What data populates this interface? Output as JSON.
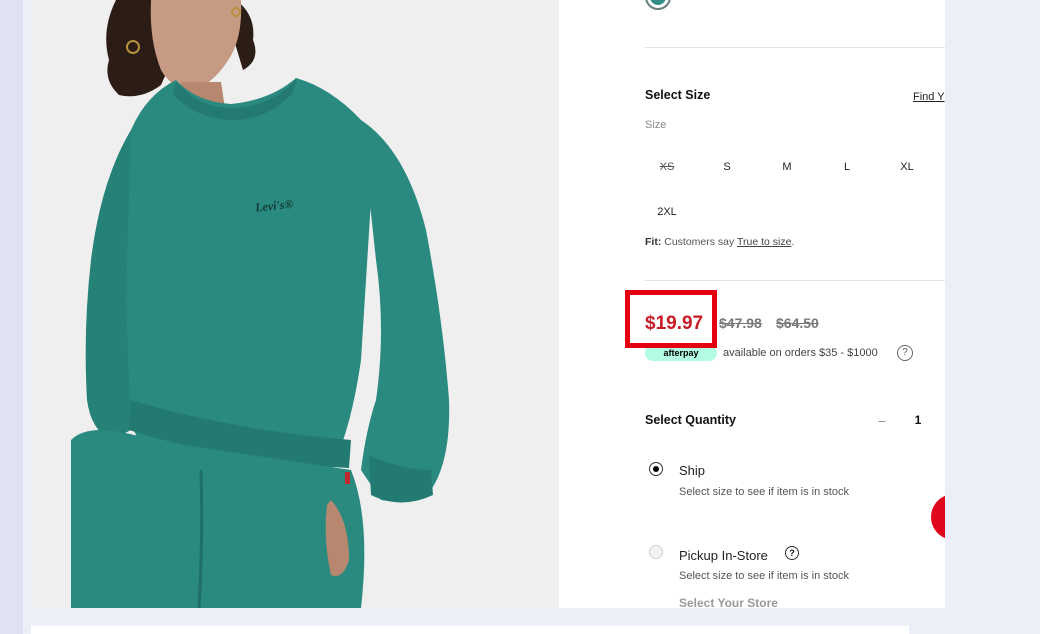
{
  "product": {
    "brand_mark": "Levi's"
  },
  "size": {
    "title": "Select Size",
    "find_link": "Find Y",
    "label": "Size",
    "options": [
      "XS",
      "S",
      "M",
      "L",
      "XL",
      "2XL"
    ],
    "unavailable": [
      "XS"
    ]
  },
  "fit": {
    "prefix": "Fit:",
    "text": "Customers say",
    "link": "True to size",
    "suffix": "."
  },
  "price": {
    "sale": "$19.97",
    "was": "$47.98",
    "original": "$64.50"
  },
  "afterpay": {
    "badge": "afterpay",
    "text": "available on orders $35 - $1000",
    "help_icon": "?"
  },
  "quantity": {
    "title": "Select Quantity",
    "minus": "–",
    "value": "1"
  },
  "fulfillment": {
    "ship": {
      "label": "Ship",
      "sub": "Select size to see if item is in stock",
      "selected": true
    },
    "pickup": {
      "label": "Pickup In-Store",
      "sub": "Select size to see if item is in stock",
      "help_icon": "?",
      "store_link": "Select Your Store",
      "selected": false
    }
  },
  "colors": {
    "sale_price": "#c81c25",
    "highlight": "#e3000f",
    "sweatshirt": "#2a8a7f",
    "afterpay_mint": "#b2fce4",
    "chat_button": "#e0061c"
  }
}
